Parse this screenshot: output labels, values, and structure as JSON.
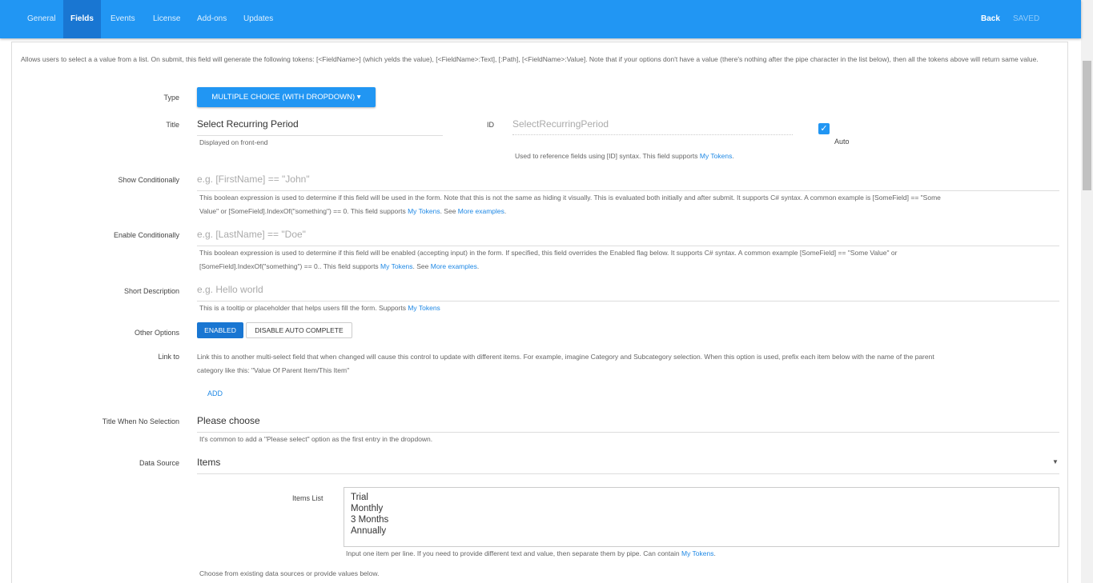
{
  "nav": {
    "tabs": [
      {
        "label": "General"
      },
      {
        "label": "Fields"
      },
      {
        "label": "Events"
      },
      {
        "label": "License"
      },
      {
        "label": "Add-ons"
      },
      {
        "label": "Updates"
      }
    ],
    "active_tab": "Fields",
    "back_label": "Back",
    "saved_label": "SAVED"
  },
  "intro": "Allows users to select a a value from a list. On submit, this field will generate the following tokens: [<FieldName>] (which yelds the value), [<FieldName>:Text], [:Path], [<FieldName>:Value]. Note that if your options don't have a value (there's nothing after the pipe character in the list below), then all the tokens above will return same value.",
  "type": {
    "label": "Type",
    "button_label": "MULTIPLE CHOICE (WITH DROPDOWN) ▾"
  },
  "title": {
    "label": "Title",
    "value": "Select Recurring Period",
    "hint": "Displayed on front-end"
  },
  "id": {
    "label": "ID",
    "placeholder": "SelectRecurringPeriod",
    "auto_label": "Auto",
    "hint_prefix": "Used to reference fields using [ID] syntax. This field supports ",
    "hint_link": "My Tokens",
    "hint_suffix": "."
  },
  "show_conditionally": {
    "label": "Show Conditionally",
    "placeholder": "e.g. [FirstName] == \"John\"",
    "hint_line1": "This boolean expression is used to determine if this field will be used in the form. Note that this is not the same as hiding it visually. This is evaluated both initially and after submit. It supports C# syntax. A common example is [SomeField] == \"Some",
    "hint_line2_prefix": "Value\" or [SomeField].IndexOf(\"something\") == 0. This field supports ",
    "hint_link1": "My Tokens",
    "hint_mid": ". See ",
    "hint_link2": "More examples",
    "hint_suffix": "."
  },
  "enable_conditionally": {
    "label": "Enable Conditionally",
    "placeholder": "e.g. [LastName] == \"Doe\"",
    "hint_line1": "This boolean expression is used to determine if this field will be enabled (accepting input) in the form. If specified, this field overrides the Enabled flag below. It supports C# syntax. A common example [SomeField] == \"Some Value\" or",
    "hint_line2_prefix": "[SomeField].IndexOf(\"something\") == 0.. This field supports ",
    "hint_link1": "My Tokens",
    "hint_mid": ". See ",
    "hint_link2": "More examples",
    "hint_suffix": "."
  },
  "short_description": {
    "label": "Short Description",
    "placeholder": "e.g. Hello world",
    "hint_prefix": "This is a tooltip or placeholder that helps users fill the form. Supports ",
    "hint_link": "My Tokens"
  },
  "other_options": {
    "label": "Other Options",
    "enabled_label": "ENABLED",
    "disable_autocomplete_label": "DISABLE AUTO COMPLETE"
  },
  "link_to": {
    "label": "Link to",
    "text_line1": "Link this to another multi-select field that when changed will cause this control to update with different items. For example, imagine Category and Subcategory selection. When this option is used, prefix each item below with the name of the parent",
    "text_line2": "category like this: \"Value Of Parent Item/This Item\"",
    "add_label": "ADD"
  },
  "title_no_selection": {
    "label": "Title When No Selection",
    "value": "Please choose",
    "hint": "It's common to add a \"Please select\" option as the first entry in the dropdown."
  },
  "data_source": {
    "label": "Data Source",
    "value": "Items",
    "hint": "Choose from existing data sources or provide values below."
  },
  "items_list": {
    "label": "Items List",
    "items": [
      "Trial",
      "Monthly",
      "3 Months",
      "Annually"
    ],
    "hint_prefix": "Input one item per line. If you need to provide different text and value, then separate them by pipe. Can contain ",
    "hint_link": "My Tokens",
    "hint_suffix": "."
  }
}
